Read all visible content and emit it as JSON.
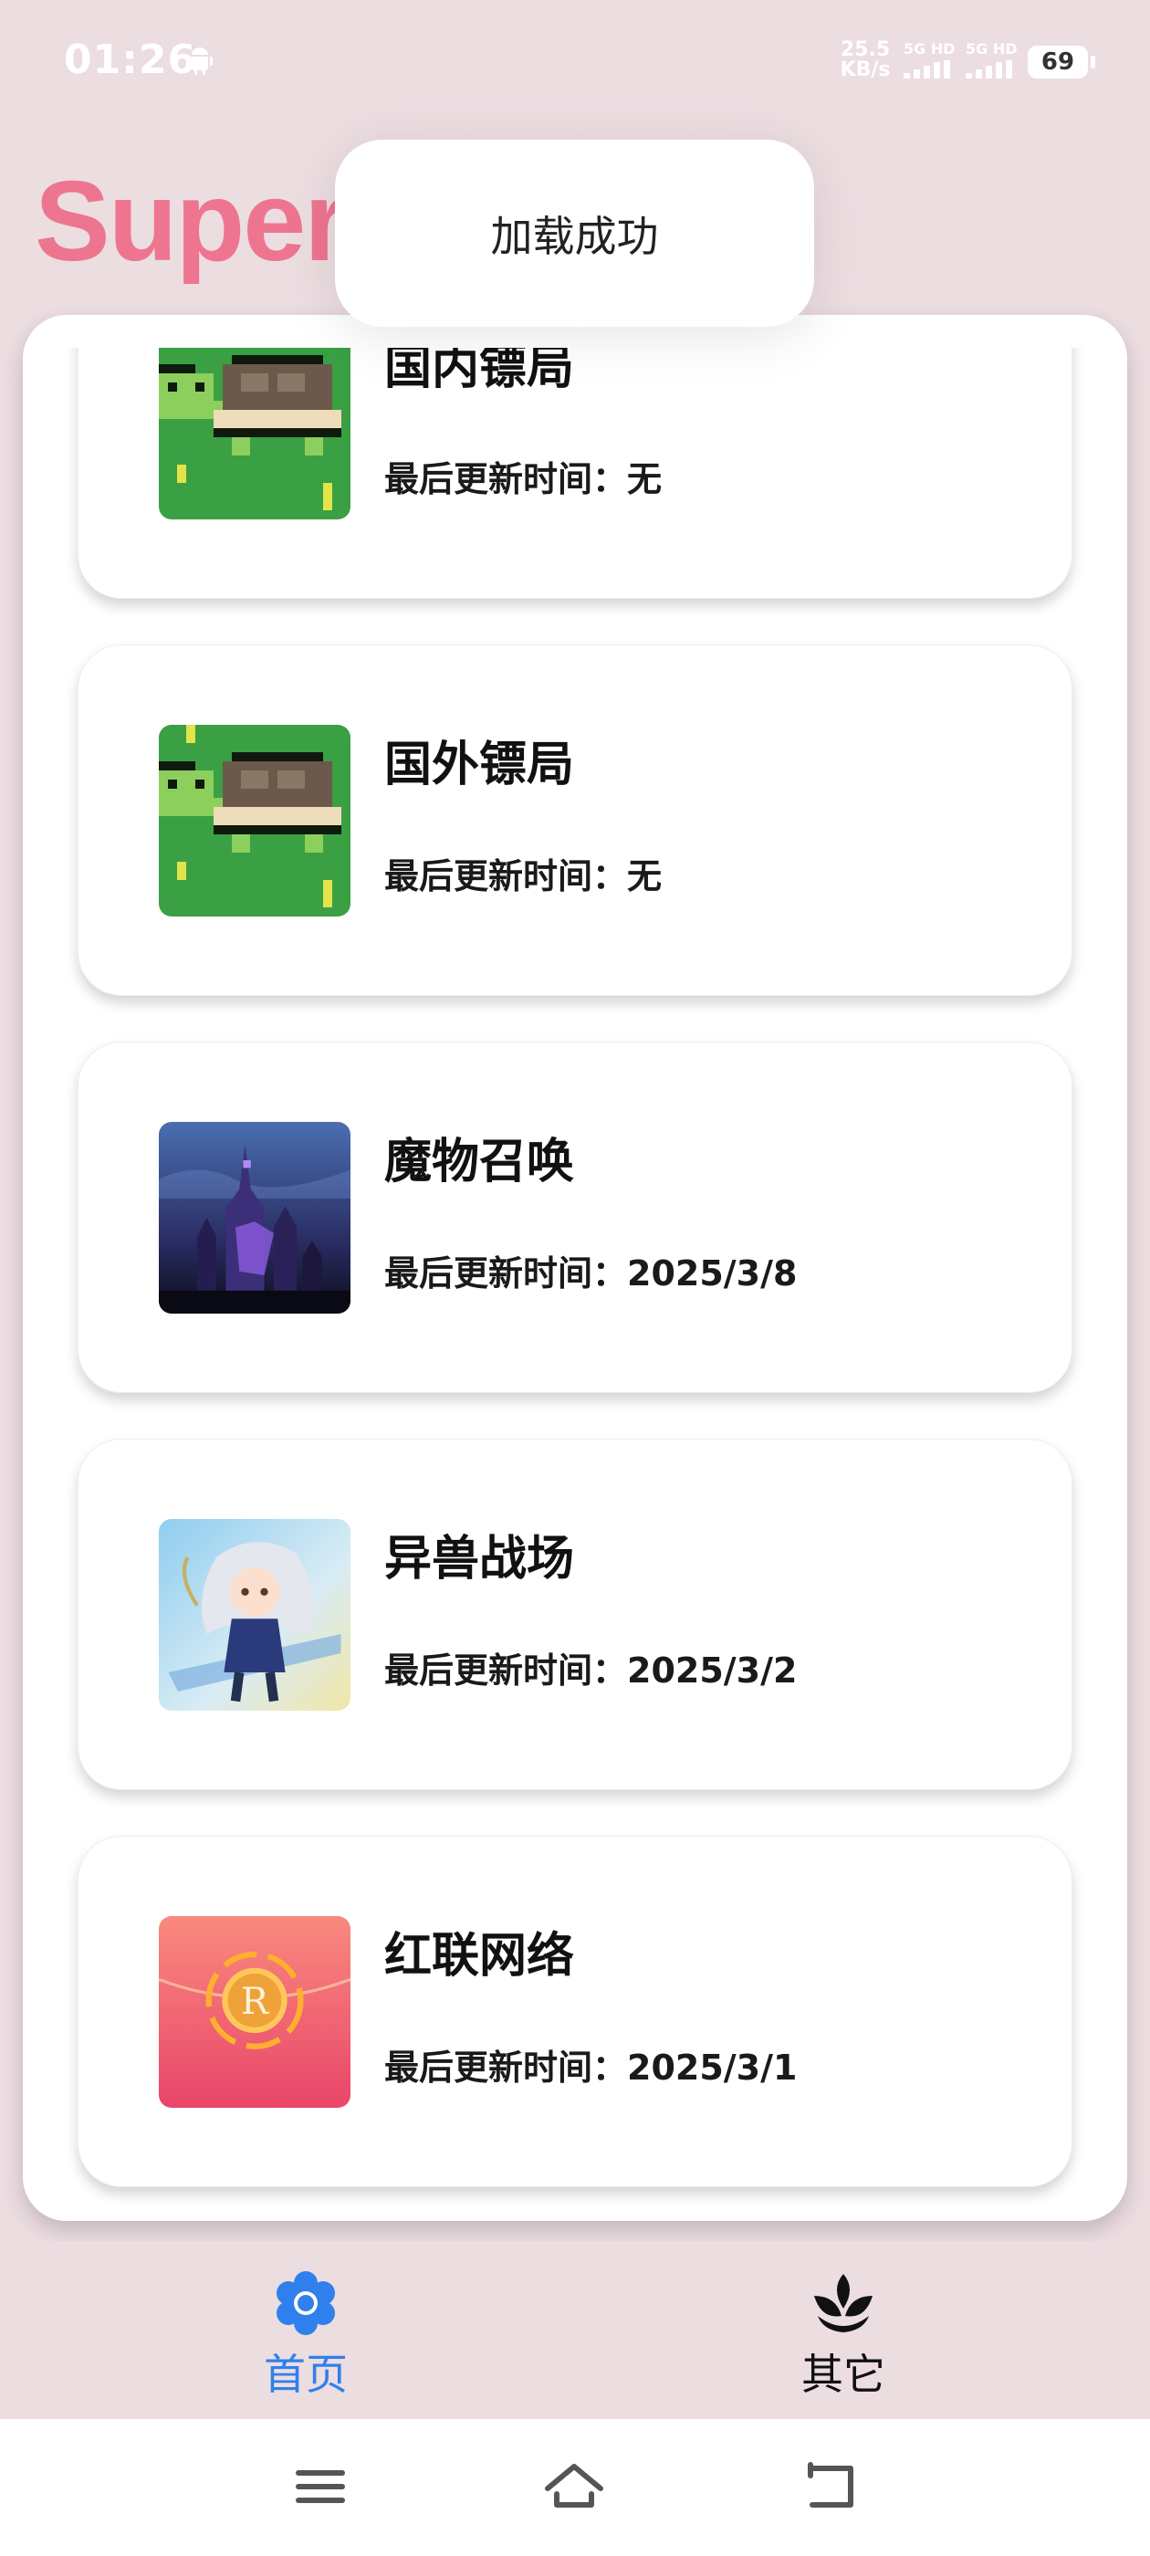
{
  "status_bar": {
    "time": "01:26",
    "net_speed_value": "25.5",
    "net_speed_unit": "KB/s",
    "sim1_label": "5G HD",
    "sim2_label": "5G HD",
    "battery": "69"
  },
  "app": {
    "title": "Super"
  },
  "toast": {
    "message": "加载成功"
  },
  "cards": [
    {
      "name": "国内镖局",
      "meta": "最后更新时间：无",
      "icon": "turtle-icon"
    },
    {
      "name": "国外镖局",
      "meta": "最后更新时间：无",
      "icon": "turtle-icon"
    },
    {
      "name": "魔物召唤",
      "meta": "最后更新时间：2025/3/8",
      "icon": "dark-castle-icon"
    },
    {
      "name": "异兽战场",
      "meta": "最后更新时间：2025/3/2",
      "icon": "anime-character-icon"
    },
    {
      "name": "红联网络",
      "meta": "最后更新时间：2025/3/1",
      "icon": "red-envelope-icon"
    }
  ],
  "bottom_nav": {
    "home_label": "首页",
    "other_label": "其它",
    "active_color": "#2f80ed"
  },
  "colors": {
    "background": "#ecdde1",
    "title": "#ee7590"
  }
}
